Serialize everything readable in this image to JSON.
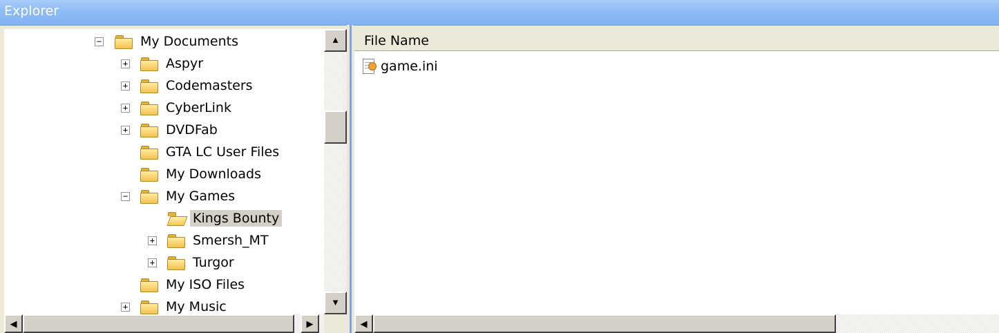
{
  "window": {
    "title": "Explorer"
  },
  "tree": {
    "items": [
      {
        "label": "My Documents",
        "expander": "−",
        "selected": false,
        "open": false
      },
      {
        "label": "Aspyr",
        "expander": "+",
        "selected": false,
        "open": false
      },
      {
        "label": "Codemasters",
        "expander": "+",
        "selected": false,
        "open": false
      },
      {
        "label": "CyberLink",
        "expander": "+",
        "selected": false,
        "open": false
      },
      {
        "label": "DVDFab",
        "expander": "+",
        "selected": false,
        "open": false
      },
      {
        "label": "GTA LC User Files",
        "expander": "",
        "selected": false,
        "open": false
      },
      {
        "label": "My Downloads",
        "expander": "",
        "selected": false,
        "open": false
      },
      {
        "label": "My Games",
        "expander": "−",
        "selected": false,
        "open": false
      },
      {
        "label": "Kings Bounty",
        "expander": "",
        "selected": true,
        "open": true
      },
      {
        "label": "Smersh_MT",
        "expander": "+",
        "selected": false,
        "open": false
      },
      {
        "label": "Turgor",
        "expander": "+",
        "selected": false,
        "open": false
      },
      {
        "label": "My ISO Files",
        "expander": "",
        "selected": false,
        "open": false
      },
      {
        "label": "My Music",
        "expander": "+",
        "selected": false,
        "open": false
      }
    ]
  },
  "scroll": {
    "up_glyph": "▲",
    "down_glyph": "▼",
    "left_glyph": "◀",
    "right_glyph": "▶"
  },
  "file_list": {
    "column_header": "File Name",
    "files": [
      {
        "name": "game.ini",
        "icon": "ini-settings-file-icon"
      }
    ]
  },
  "colors": {
    "title_bar": "#8ebbf5",
    "selection": "#d4d0c8",
    "splitter_accent": "#7ba4de"
  }
}
